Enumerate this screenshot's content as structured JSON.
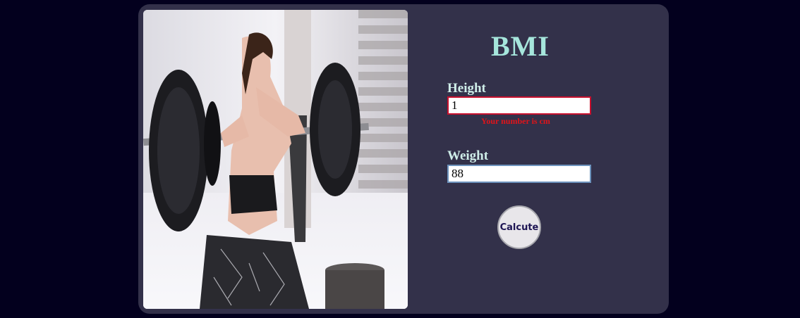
{
  "form": {
    "title": "BMI",
    "height": {
      "label": "Height",
      "value": "1",
      "error": "Your number is cm"
    },
    "weight": {
      "label": "Weight",
      "value": "88"
    },
    "calculate_button": "Calcute"
  },
  "photo": {
    "icon": "fitness-photo"
  },
  "colors": {
    "page_background": "#03001e",
    "card_background": "#33314a",
    "title": "#a6e6dc",
    "error": "#e0141a",
    "button_text": "#1d1453"
  }
}
